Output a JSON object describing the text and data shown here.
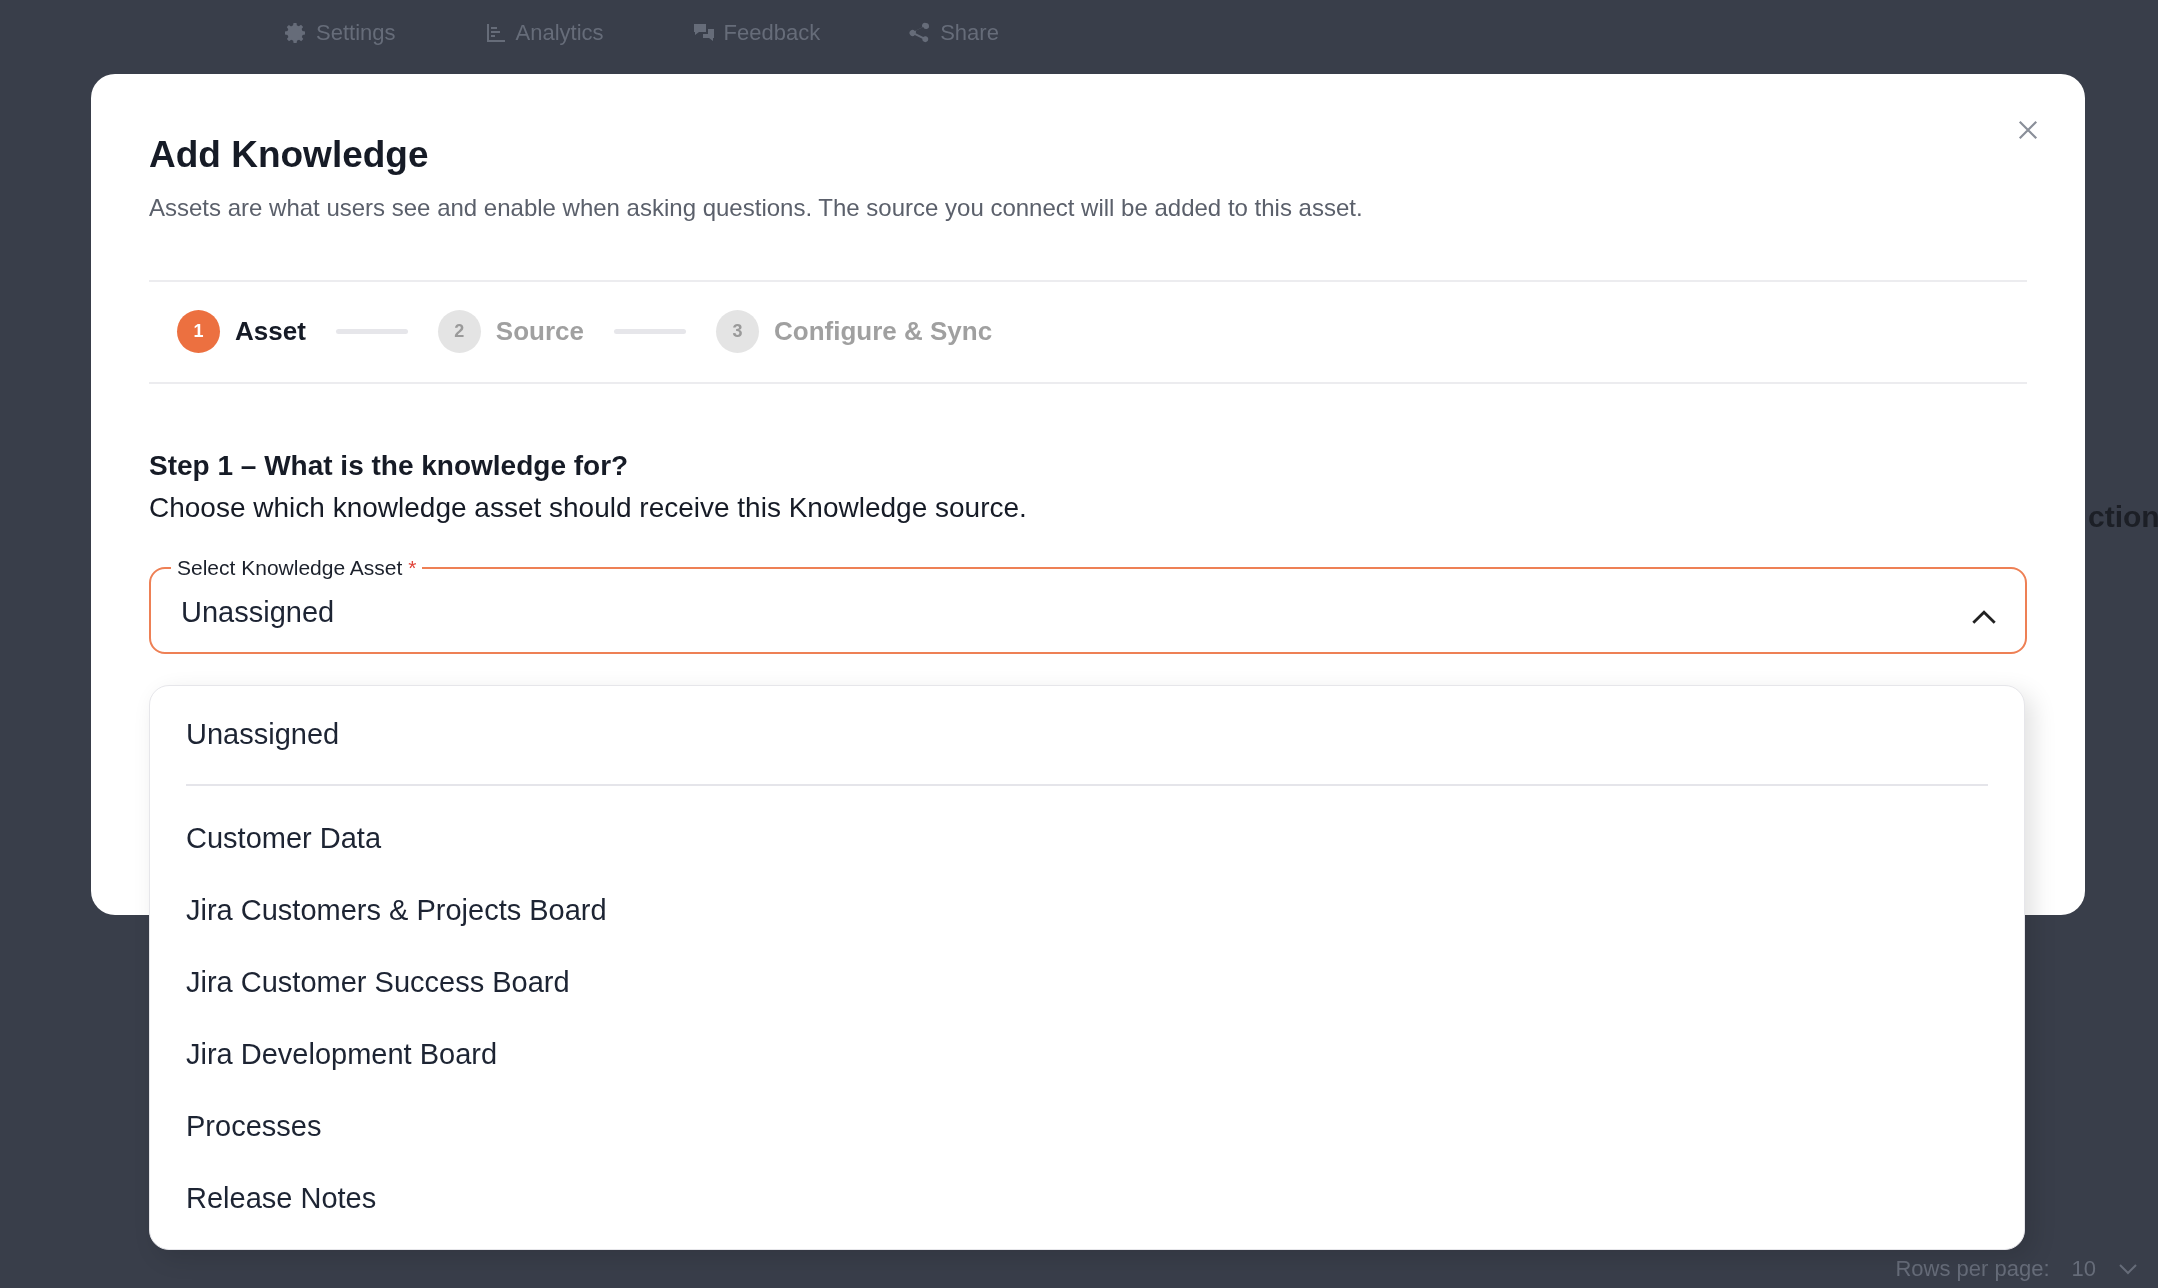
{
  "background": {
    "nav": [
      {
        "label": "Settings"
      },
      {
        "label": "Analytics"
      },
      {
        "label": "Feedback"
      },
      {
        "label": "Share"
      }
    ],
    "column_heading": "ction",
    "pagination": {
      "label": "Rows per page:",
      "value": "10"
    }
  },
  "dialog": {
    "title": "Add Knowledge",
    "subtitle": "Assets are what users see and enable when asking questions. The source you connect will be added to this asset.",
    "steps": [
      {
        "number": "1",
        "label": "Asset",
        "selected": true
      },
      {
        "number": "2",
        "label": "Source",
        "selected": false
      },
      {
        "number": "3",
        "label": "Configure & Sync",
        "selected": false
      }
    ],
    "step_title": "Step 1 – What is the knowledge for?",
    "step_description": "Choose which knowledge asset should receive this Knowledge source.",
    "select": {
      "label": "Select Knowledge Asset",
      "required_mark": "*",
      "value": "Unassigned",
      "expanded": true
    },
    "options": [
      {
        "label": "Unassigned",
        "divider_after": true
      },
      {
        "label": "Customer Data",
        "divider_after": false
      },
      {
        "label": "Jira Customers & Projects Board",
        "divider_after": false
      },
      {
        "label": "Jira Customer Success Board",
        "divider_after": false
      },
      {
        "label": "Jira Development Board",
        "divider_after": false
      },
      {
        "label": "Processes",
        "divider_after": false
      },
      {
        "label": "Release Notes",
        "divider_after": false
      }
    ]
  }
}
